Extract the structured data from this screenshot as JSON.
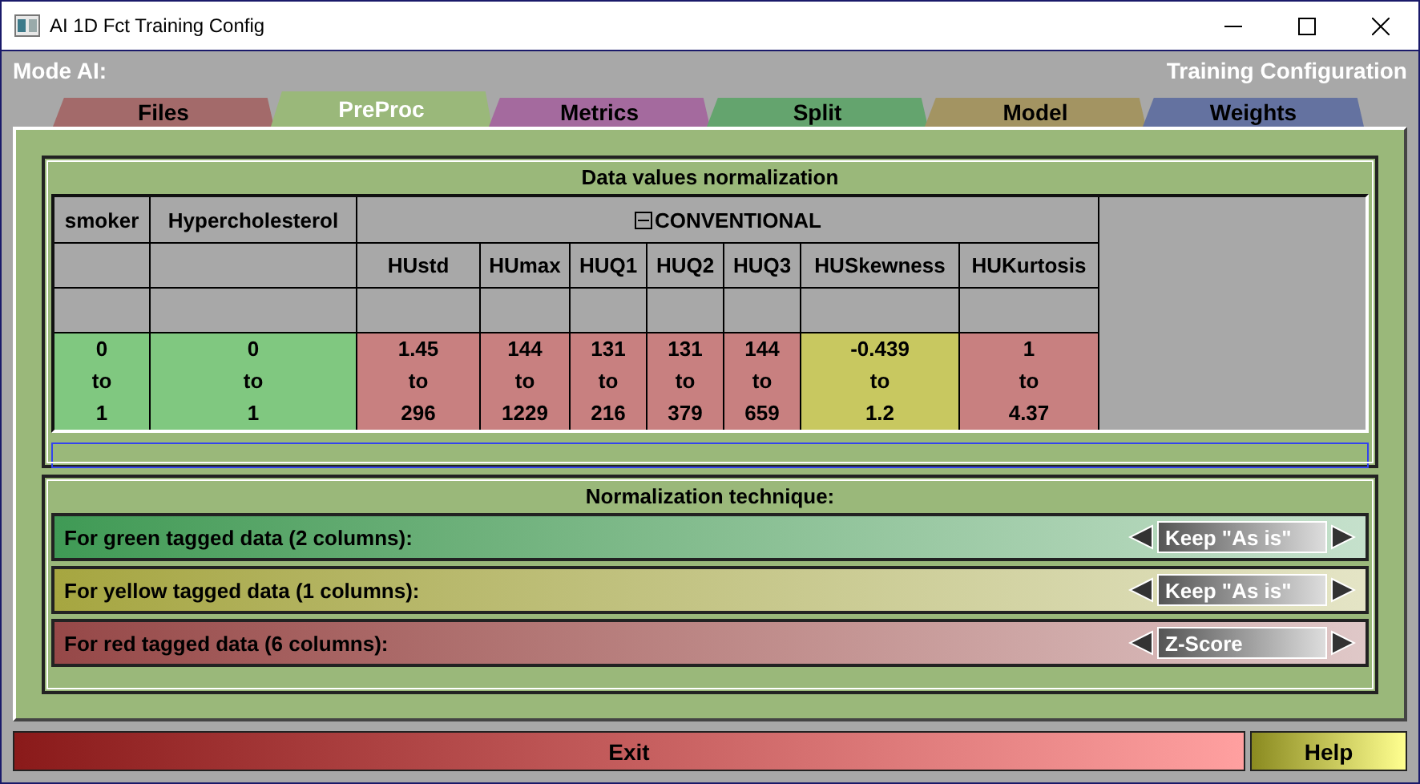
{
  "window": {
    "title": "AI 1D Fct Training Config"
  },
  "header": {
    "mode_label": "Mode AI:",
    "config_label": "Training Configuration"
  },
  "tabs": [
    {
      "label": "Files",
      "selected": false,
      "color": "#a36a6a"
    },
    {
      "label": "PreProc",
      "selected": true,
      "color": "#9ab87a"
    },
    {
      "label": "Metrics",
      "selected": false,
      "color": "#a46a9e"
    },
    {
      "label": "Split",
      "selected": false,
      "color": "#64a46e"
    },
    {
      "label": "Model",
      "selected": false,
      "color": "#a39462"
    },
    {
      "label": "Weights",
      "selected": false,
      "color": "#6472a0"
    }
  ],
  "normalization_table": {
    "title": "Data values normalization",
    "ungrouped_columns": [
      {
        "header": "smoker",
        "color": "#80c880",
        "min": "0",
        "sep": "to",
        "max": "1"
      },
      {
        "header": "Hypercholesterol",
        "color": "#80c880",
        "min": "0",
        "sep": "to",
        "max": "1"
      }
    ],
    "group": {
      "title": "CONVENTIONAL",
      "expanded": true,
      "columns": [
        {
          "header": "HUstd",
          "color": "#c88080",
          "min": "1.45",
          "sep": "to",
          "max": "296"
        },
        {
          "header": "HUmax",
          "color": "#c88080",
          "min": "144",
          "sep": "to",
          "max": "1229"
        },
        {
          "header": "HUQ1",
          "color": "#c88080",
          "min": "131",
          "sep": "to",
          "max": "216"
        },
        {
          "header": "HUQ2",
          "color": "#c88080",
          "min": "131",
          "sep": "to",
          "max": "379"
        },
        {
          "header": "HUQ3",
          "color": "#c88080",
          "min": "144",
          "sep": "to",
          "max": "659"
        },
        {
          "header": "HUSkewness",
          "color": "#c8c860",
          "min": "-0.439",
          "sep": "to",
          "max": "1.2"
        },
        {
          "header": "HUKurtosis",
          "color": "#c88080",
          "min": "1",
          "sep": "to",
          "max": "4.37"
        }
      ]
    }
  },
  "progress": {
    "level": 0
  },
  "technique": {
    "title": "Normalization technique:",
    "rows": [
      {
        "label": "For green tagged data (2 columns):",
        "color": "#3f9a55",
        "value": "Keep \"As is\""
      },
      {
        "label": "For yellow tagged data (1 columns):",
        "color": "#a6a640",
        "value": "Keep \"As is\""
      },
      {
        "label": "For red tagged data (6 columns):",
        "color": "#964848",
        "value": "Z-Score"
      }
    ]
  },
  "buttons": {
    "exit": "Exit",
    "help": "Help"
  }
}
